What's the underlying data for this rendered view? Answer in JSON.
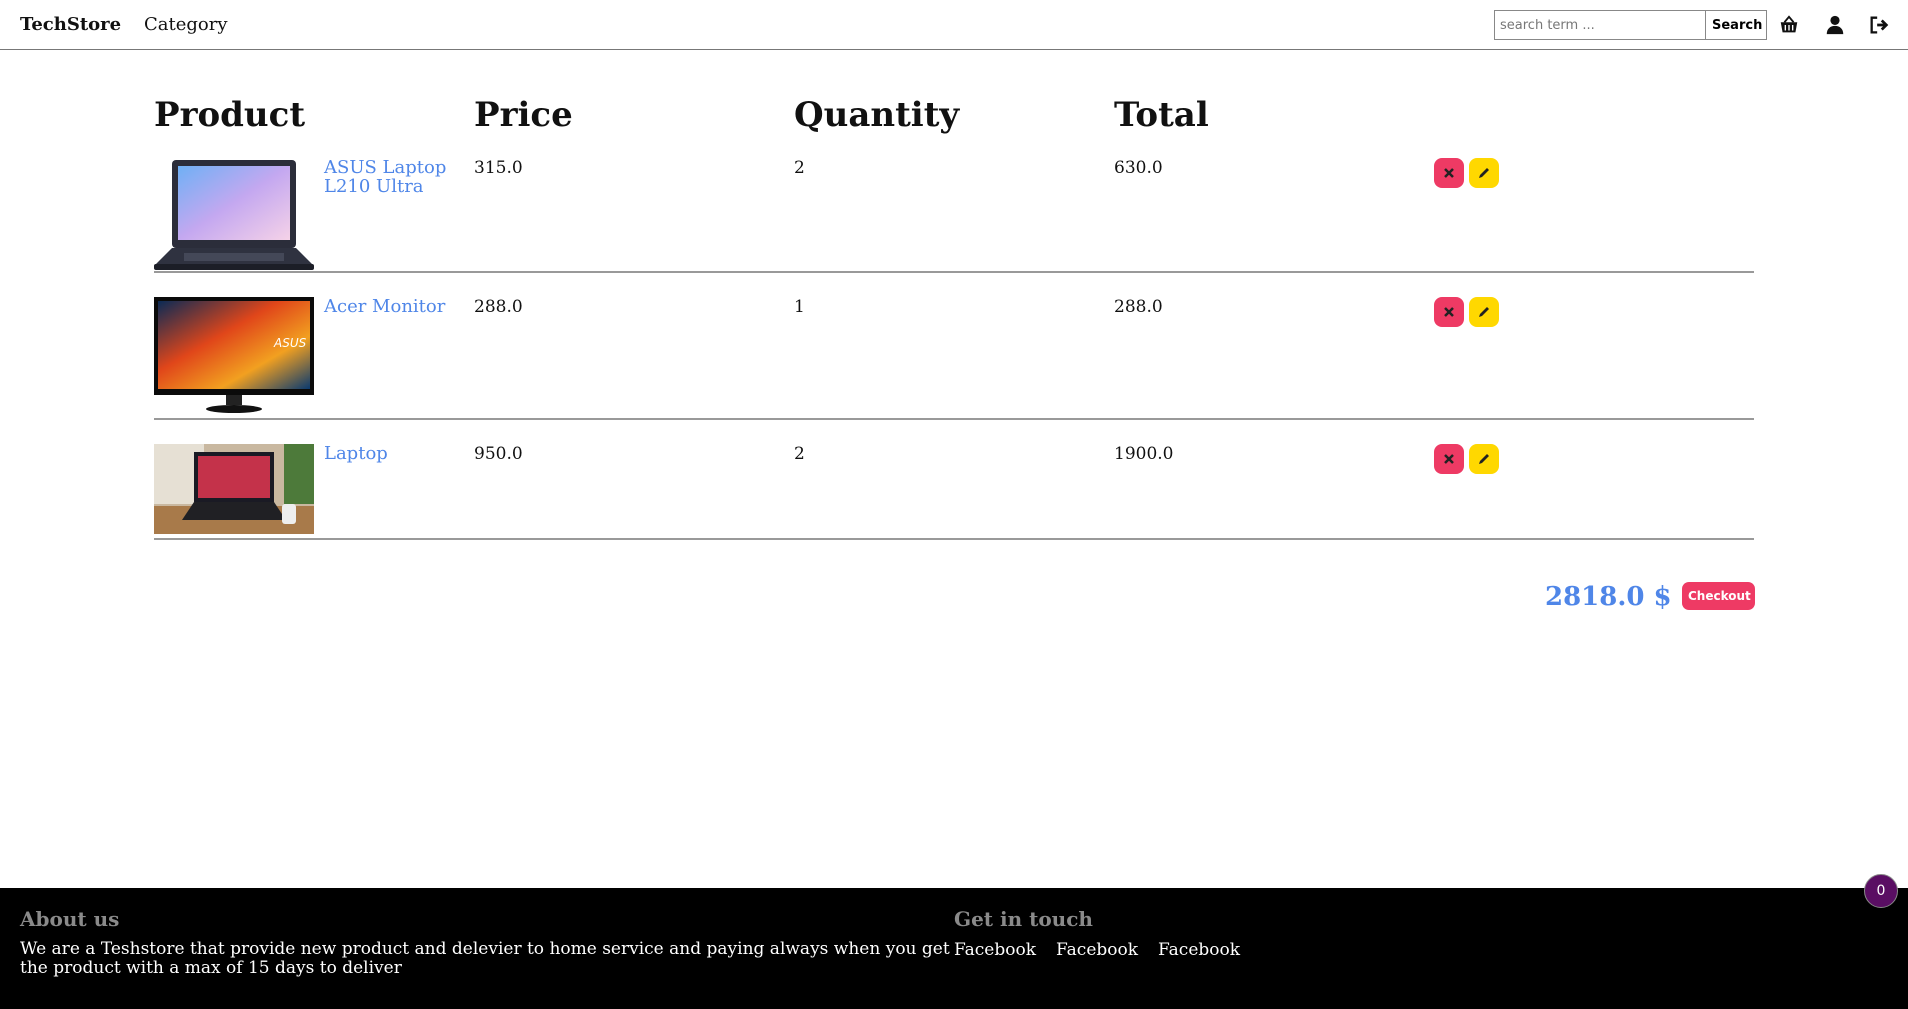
{
  "navbar": {
    "brand": "TechStore",
    "category": "Category",
    "search_placeholder": "search term ...",
    "search_label": "Search",
    "icons": [
      "basket-icon",
      "user-icon",
      "logout-icon"
    ]
  },
  "cart": {
    "headers": {
      "product": "Product",
      "price": "Price",
      "quantity": "Quantity",
      "total": "Total"
    },
    "items": [
      {
        "name": "ASUS Laptop L210 Ultra",
        "price": "315.0",
        "quantity": "2",
        "total": "630.0"
      },
      {
        "name": "Acer Monitor",
        "price": "288.0",
        "quantity": "1",
        "total": "288.0"
      },
      {
        "name": "Laptop",
        "price": "950.0",
        "quantity": "2",
        "total": "1900.0"
      }
    ],
    "grand_total": "2818.0 $",
    "checkout_label": "Checkout"
  },
  "footer": {
    "about_title": "About us",
    "about_text": "We are a Teshstore that provide new product and delevier to home service and paying always when you get the product with a max of 15 days to deliver",
    "contact_title": "Get in touch",
    "links": [
      "Facebook",
      "Facebook",
      "Facebook"
    ]
  },
  "cart_badge": "0",
  "colors": {
    "accent_blue": "#4f86e8",
    "delete_red": "#ee3a64",
    "edit_yellow": "#ffd800",
    "badge_purple": "#5a0e63"
  }
}
